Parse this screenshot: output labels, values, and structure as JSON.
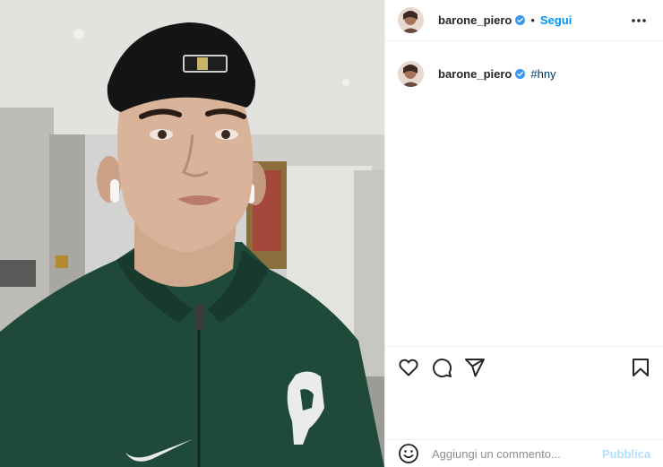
{
  "post": {
    "username": "barone_piero",
    "verified": true,
    "follow_separator": "•",
    "follow_label": "Segui",
    "more_icon": "more-horizontal-icon",
    "caption_hashtag": "#hny"
  },
  "actions": {
    "like_icon": "heart-icon",
    "comment_icon": "comment-icon",
    "share_icon": "send-icon",
    "save_icon": "bookmark-icon"
  },
  "comment_bar": {
    "placeholder": "Aggiungi un commento...",
    "publish_label": "Pubblica"
  },
  "colors": {
    "link_blue": "#0095f6",
    "verified_blue": "#3897f0",
    "hoodie_green": "#1f4a3a",
    "border": "#efefef"
  }
}
